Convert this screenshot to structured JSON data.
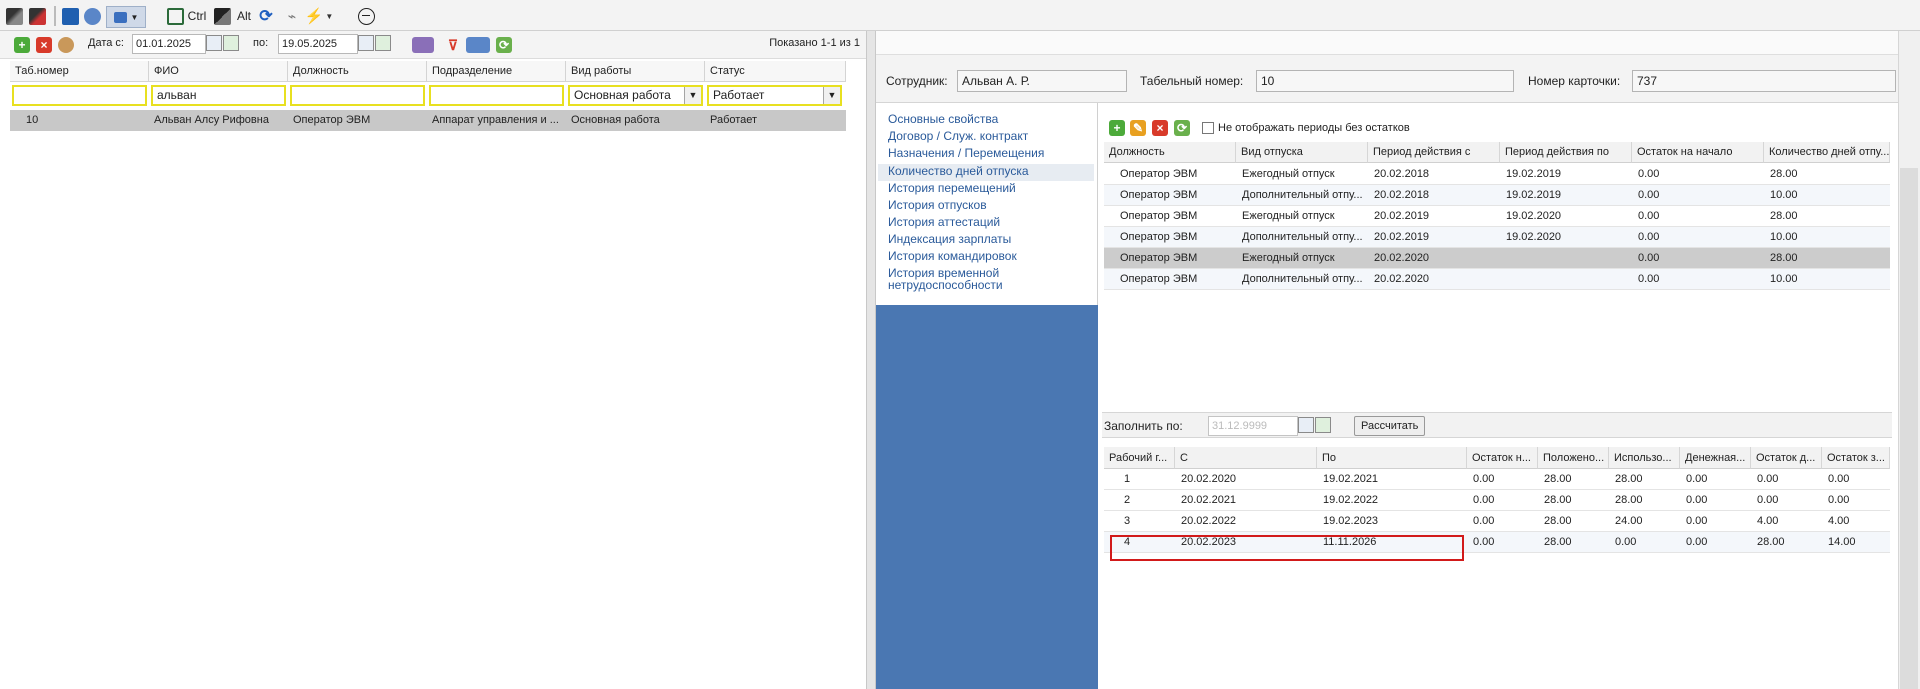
{
  "toolbar": {
    "ctrl_label": "Ctrl",
    "alt_label": "Alt"
  },
  "left": {
    "date_from_label": "Дата с:",
    "date_from": "01.01.2025",
    "date_to_label": "по:",
    "date_to": "19.05.2025",
    "shown": "Показано 1-1 из 1",
    "columns": [
      "Таб.номер",
      "ФИО",
      "Должность",
      "Подразделение",
      "Вид работы",
      "Статус"
    ],
    "filters": [
      "",
      "альван",
      "",
      "",
      "Основная работа",
      "Работает"
    ],
    "rows": [
      [
        "10",
        "Альван Алсу Рифовна",
        "Оператор ЭВМ",
        "Аппарат управления и ...",
        "Основная работа",
        "Работает"
      ]
    ]
  },
  "employee": {
    "employee_label": "Сотрудник:",
    "employee_value": "Альван А. Р.",
    "tabnum_label": "Табельный номер:",
    "tabnum_value": "10",
    "card_label": "Номер карточки:",
    "card_value": "737"
  },
  "nav": {
    "items": [
      "Основные свойства",
      "Договор / Служ. контракт",
      "Назначения / Перемещения",
      "Количество дней отпуска",
      "История перемещений",
      "История отпусков",
      "История аттестаций",
      "Индексация зарплаты",
      "История командировок",
      "История временной",
      "нетрудоспособности"
    ]
  },
  "vacation": {
    "checkbox_label": "Не отображать периоды без остатков",
    "columns": [
      "Должность",
      "Вид отпуска",
      "Период действия с",
      "Период действия по",
      "Остаток на начало",
      "Количество дней отпу..."
    ],
    "rows": [
      [
        "Оператор ЭВМ",
        "Ежегодный отпуск",
        "20.02.2018",
        "19.02.2019",
        "0.00",
        "28.00"
      ],
      [
        "Оператор ЭВМ",
        "Дополнительный отпу...",
        "20.02.2018",
        "19.02.2019",
        "0.00",
        "10.00"
      ],
      [
        "Оператор ЭВМ",
        "Ежегодный отпуск",
        "20.02.2019",
        "19.02.2020",
        "0.00",
        "28.00"
      ],
      [
        "Оператор ЭВМ",
        "Дополнительный отпу...",
        "20.02.2019",
        "19.02.2020",
        "0.00",
        "10.00"
      ],
      [
        "Оператор ЭВМ",
        "Ежегодный отпуск",
        "20.02.2020",
        "",
        "0.00",
        "28.00"
      ],
      [
        "Оператор ЭВМ",
        "Дополнительный отпу...",
        "20.02.2020",
        "",
        "0.00",
        "10.00"
      ]
    ]
  },
  "fill": {
    "label": "Заполнить по:",
    "placeholder": "31.12.9999",
    "button": "Рассчитать"
  },
  "workyears": {
    "columns": [
      "Рабочий г...",
      "С",
      "По",
      "Остаток н...",
      "Положено...",
      "Использо...",
      "Денежная...",
      "Остаток д...",
      "Остаток з..."
    ],
    "rows": [
      [
        "1",
        "20.02.2020",
        "19.02.2021",
        "0.00",
        "28.00",
        "28.00",
        "0.00",
        "0.00",
        "0.00"
      ],
      [
        "2",
        "20.02.2021",
        "19.02.2022",
        "0.00",
        "28.00",
        "28.00",
        "0.00",
        "0.00",
        "0.00"
      ],
      [
        "3",
        "20.02.2022",
        "19.02.2023",
        "0.00",
        "28.00",
        "24.00",
        "0.00",
        "4.00",
        "4.00"
      ],
      [
        "4",
        "20.02.2023",
        "11.11.2026",
        "0.00",
        "28.00",
        "0.00",
        "0.00",
        "28.00",
        "14.00"
      ]
    ]
  },
  "colors": {
    "nav_bg": "#4a77b2",
    "filter_border": "#e8e020",
    "highlight": "#d21a1a"
  }
}
